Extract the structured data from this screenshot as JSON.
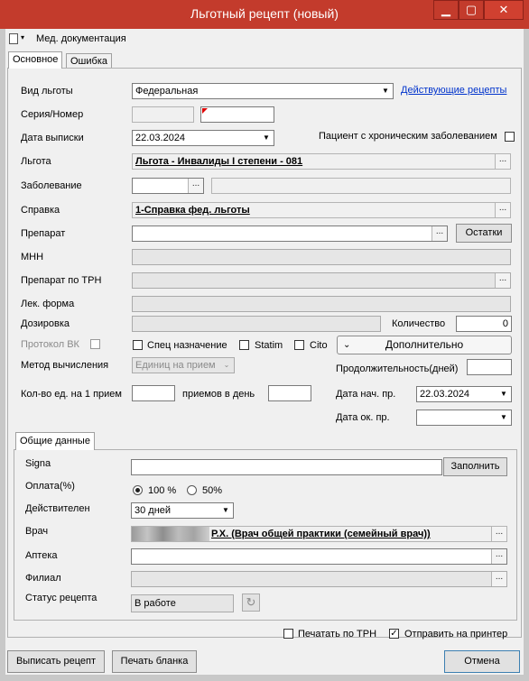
{
  "window": {
    "title": "Льготный рецепт (новый)",
    "min_glyph": "▁",
    "max_glyph": "▢",
    "close_glyph": "✕"
  },
  "toolbar": {
    "menu_label": "Мед. документация"
  },
  "tabs": {
    "main": "Основное",
    "error": "Ошибка"
  },
  "form": {
    "benefit_type": {
      "label": "Вид льготы",
      "value": "Федеральная",
      "link": "Действующие рецепты"
    },
    "series_number": {
      "label": "Серия/Номер",
      "series": "",
      "number": ""
    },
    "issue_date": {
      "label": "Дата выписки",
      "value": "22.03.2024"
    },
    "chronic": {
      "label": "Пациент с хроническим заболеванием",
      "checked": false
    },
    "benefit": {
      "label": "Льгота",
      "value": "Льгота - Инвалиды I степени - 081"
    },
    "disease": {
      "label": "Заболевание",
      "code": "",
      "name": ""
    },
    "certificate": {
      "label": "Справка",
      "value": "1-Справка фед. льготы"
    },
    "drug": {
      "label": "Препарат",
      "value": "",
      "stock_button": "Остатки"
    },
    "inn": {
      "label": "МНН",
      "value": ""
    },
    "trn_drug": {
      "label": "Препарат по ТРН",
      "value": ""
    },
    "dosage_form": {
      "label": "Лек. форма",
      "value": ""
    },
    "dosage": {
      "label": "Дозировка",
      "value": ""
    },
    "quantity": {
      "label": "Количество",
      "value": "0"
    },
    "vk_protocol": {
      "label": "Протокол ВК",
      "checked": false
    },
    "special": {
      "label": "Спец назначение",
      "checked": false
    },
    "statim": {
      "label": "Statim",
      "checked": false
    },
    "cito": {
      "label": "Cito",
      "checked": false
    },
    "additional_button": "Дополнительно",
    "calc_method": {
      "label": "Метод вычисления",
      "value": "Единиц на прием"
    },
    "duration": {
      "label": "Продолжительность(дней)",
      "value": ""
    },
    "units_per_dose": {
      "label": "Кол-во ед. на 1 прием",
      "value": ""
    },
    "doses_per_day": {
      "label": "приемов в день",
      "value": ""
    },
    "start_date": {
      "label": "Дата нач. пр.",
      "value": "22.03.2024"
    },
    "end_date": {
      "label": "Дата ок. пр.",
      "value": ""
    }
  },
  "general": {
    "tab": "Общие данные",
    "signa": {
      "label": "Signa",
      "value": "",
      "fill_button": "Заполнить"
    },
    "payment": {
      "label": "Оплата(%)",
      "opt100": "100 %",
      "opt50": "50%",
      "selected": "100 %"
    },
    "valid": {
      "label": "Действителен",
      "value": "30 дней"
    },
    "doctor": {
      "label": "Врач",
      "value": "Р.Х. (Врач общей практики (семейный врач))"
    },
    "pharmacy": {
      "label": "Аптека",
      "value": ""
    },
    "branch": {
      "label": "Филиал",
      "value": ""
    },
    "status": {
      "label": "Статус рецепта",
      "value": "В работе"
    }
  },
  "footer": {
    "print_trn": {
      "label": "Печатать по ТРН",
      "checked": false
    },
    "send_printer": {
      "label": "Отправить на принтер",
      "checked": true,
      "mark": "✓"
    },
    "issue_button": "Выписать рецепт",
    "print_form_button": "Печать бланка",
    "cancel_button": "Отмена"
  },
  "colors": {
    "titlebar": "#c33b2c",
    "link": "#0033cc",
    "window_bg": "#f0f0f0"
  }
}
